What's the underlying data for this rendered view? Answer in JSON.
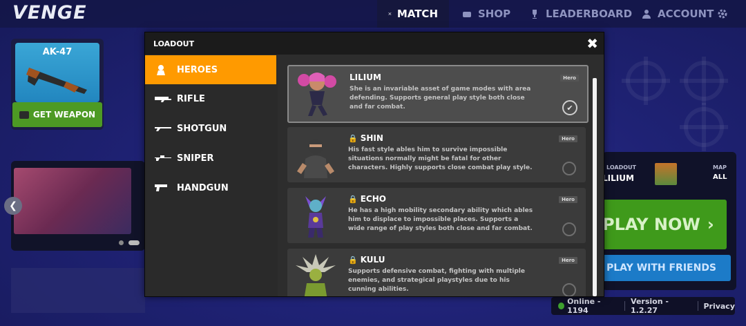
{
  "app": {
    "logo": "VENGE"
  },
  "nav": [
    {
      "label": "MATCH",
      "icon": "swords-icon",
      "active": true
    },
    {
      "label": "SHOP",
      "icon": "shop-icon",
      "active": false
    },
    {
      "label": "LEADERBOARD",
      "icon": "trophy-icon",
      "active": false
    },
    {
      "label": "ACCOUNT",
      "icon": "user-icon",
      "active": false
    }
  ],
  "weapon_card": {
    "title": "AK-47",
    "button": "GET WEAPON"
  },
  "right_panel": {
    "loadout_label": "LOADOUT",
    "loadout_value": "LILIUM",
    "map_label": "MAP",
    "map_value": "ALL",
    "play_now": "PLAY NOW",
    "play_friends": "PLAY WITH FRIENDS"
  },
  "status": {
    "online": "Online - 1194",
    "version": "Version - 1.2.27",
    "privacy": "Privacy"
  },
  "modal": {
    "title": "LOADOUT",
    "close": "✖",
    "categories": [
      "HEROES",
      "RIFLE",
      "SHOTGUN",
      "SNIPER",
      "HANDGUN"
    ],
    "active_category": "HEROES",
    "heroes": [
      {
        "name": "LILIUM",
        "locked": false,
        "selected": true,
        "badge": "Hero",
        "desc": "She is an invariable asset of game modes with area defending. Supports general play style both close and far combat."
      },
      {
        "name": "SHIN",
        "locked": true,
        "selected": false,
        "badge": "Hero",
        "desc": "His fast style ables him to survive impossible situations normally might be fatal for other characters. Highly supports close combat play style."
      },
      {
        "name": "ECHO",
        "locked": true,
        "selected": false,
        "badge": "Hero",
        "desc": "He has a high mobility secondary ability which ables him to displace to impossible places. Supports a wide range of play styles both close and far combat."
      },
      {
        "name": "KULU",
        "locked": true,
        "selected": false,
        "badge": "Hero",
        "desc": "Supports defensive combat, fighting with multiple enemies, and strategical playstyles due to his cunning abilities."
      }
    ]
  },
  "colors": {
    "accent": "#ff9a00",
    "play_green": "#3f9a1b",
    "friends_blue": "#1c7bc8"
  }
}
